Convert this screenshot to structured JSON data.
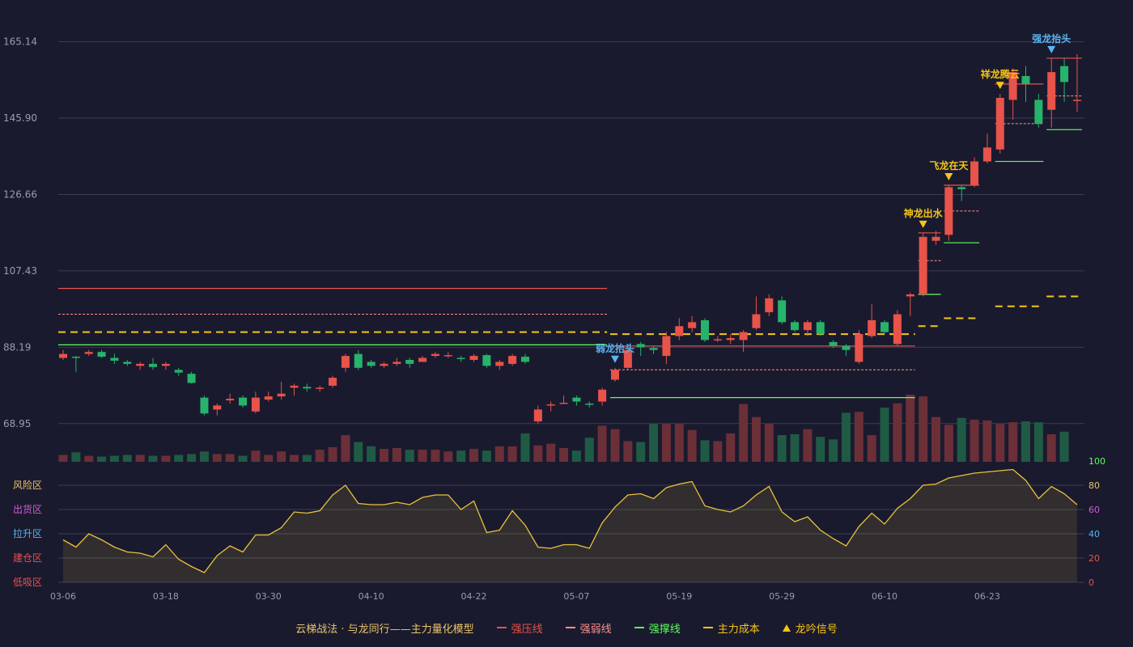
{
  "colors": {
    "background": "#1a1a2e",
    "grid": "#3a3d52",
    "up": "#e8534a",
    "down": "#26b36b",
    "volume_up": "#6b2f38",
    "volume_down": "#1f5a45",
    "strong_pressure": "#e8534a",
    "strong_weak": "#ff8f8f",
    "strong_support": "#5dff5d",
    "main_cost": "#f5c518",
    "signal_gold": "#f5c518",
    "signal_blue": "#5ab4f0",
    "oscillator_line": "#e8c23a",
    "axis_text": "#9a9cb0"
  },
  "legend": {
    "title": "云梯战法 · 与龙同行——主力量化模型",
    "strong_pressure": "强压线",
    "strong_weak": "强弱线",
    "strong_support": "强撑线",
    "main_cost": "主力成本",
    "signal": "龙吟信号"
  },
  "chart_data": {
    "type": "candlestick",
    "price_axis": {
      "ylim": [
        59.33,
        169.95
      ],
      "ticks": [
        "165.14",
        "145.90",
        "126.66",
        "107.43",
        "88.19",
        "68.95"
      ]
    },
    "x_tick_labels": [
      {
        "index": 0,
        "label": "03-06"
      },
      {
        "index": 8,
        "label": "03-18"
      },
      {
        "index": 16,
        "label": "03-30"
      },
      {
        "index": 24,
        "label": "04-10"
      },
      {
        "index": 32,
        "label": "04-22"
      },
      {
        "index": 40,
        "label": "05-07"
      },
      {
        "index": 48,
        "label": "05-19"
      },
      {
        "index": 56,
        "label": "05-29"
      },
      {
        "index": 64,
        "label": "06-10"
      },
      {
        "index": 72,
        "label": "06-23"
      }
    ],
    "candles": [
      [
        85.5,
        86.5,
        87.5,
        85.0
      ],
      [
        85.8,
        85.5,
        86.0,
        82.0
      ],
      [
        86.5,
        87.0,
        87.5,
        86.0
      ],
      [
        87.0,
        85.8,
        87.5,
        85.5
      ],
      [
        85.5,
        84.8,
        86.5,
        84.0
      ],
      [
        84.5,
        84.0,
        85.0,
        83.5
      ],
      [
        83.5,
        84.0,
        84.5,
        82.5
      ],
      [
        84.0,
        83.2,
        85.5,
        82.5
      ],
      [
        83.5,
        84.0,
        84.5,
        82.5
      ],
      [
        82.5,
        81.8,
        83.0,
        81.0
      ],
      [
        81.5,
        79.2,
        82.0,
        79.0
      ],
      [
        75.5,
        71.5,
        76.0,
        71.0
      ],
      [
        72.5,
        73.5,
        74.0,
        71.0
      ],
      [
        74.8,
        75.2,
        76.5,
        74.0
      ],
      [
        75.5,
        73.5,
        76.0,
        73.0
      ],
      [
        72.0,
        75.5,
        77.0,
        71.5
      ],
      [
        75.0,
        75.8,
        77.0,
        74.5
      ],
      [
        75.8,
        76.5,
        79.5,
        75.0
      ],
      [
        78.0,
        78.5,
        79.0,
        76.0
      ],
      [
        78.2,
        77.8,
        79.0,
        77.0
      ],
      [
        77.8,
        78.0,
        78.5,
        77.0
      ],
      [
        78.5,
        80.5,
        81.0,
        78.0
      ],
      [
        83.0,
        86.0,
        86.5,
        82.0
      ],
      [
        86.5,
        83.0,
        87.5,
        82.5
      ],
      [
        84.5,
        83.5,
        85.0,
        83.0
      ],
      [
        83.5,
        84.0,
        84.5,
        83.0
      ],
      [
        84.0,
        84.5,
        85.5,
        83.5
      ],
      [
        85.0,
        84.0,
        85.5,
        83.0
      ],
      [
        84.5,
        85.5,
        86.0,
        84.5
      ],
      [
        86.0,
        86.5,
        87.0,
        85.5
      ],
      [
        86.0,
        86.2,
        87.0,
        85.5
      ],
      [
        85.5,
        85.3,
        86.0,
        84.5
      ],
      [
        85.0,
        86.0,
        86.5,
        84.5
      ],
      [
        86.2,
        83.5,
        86.5,
        83.0
      ],
      [
        83.5,
        84.5,
        85.0,
        82.5
      ],
      [
        84.0,
        86.0,
        86.5,
        83.5
      ],
      [
        85.8,
        84.5,
        86.5,
        84.0
      ],
      [
        69.5,
        72.5,
        73.5,
        69.0
      ],
      [
        73.5,
        73.8,
        74.5,
        72.0
      ],
      [
        74.0,
        74.2,
        76.0,
        74.0
      ],
      [
        75.5,
        74.5,
        76.0,
        73.5
      ],
      [
        74.0,
        73.8,
        74.5,
        73.0
      ],
      [
        74.5,
        77.5,
        78.0,
        73.5
      ],
      [
        80.0,
        82.5,
        83.0,
        79.5
      ],
      [
        83.0,
        87.5,
        88.0,
        82.5
      ],
      [
        89.0,
        88.2,
        89.5,
        86.0
      ],
      [
        88.0,
        87.5,
        88.5,
        86.5
      ],
      [
        86.0,
        91.0,
        92.0,
        84.0
      ],
      [
        91.0,
        93.5,
        95.5,
        90.0
      ],
      [
        93.0,
        94.5,
        96.0,
        92.0
      ],
      [
        95.0,
        90.0,
        95.5,
        89.5
      ],
      [
        90.0,
        90.2,
        91.0,
        89.5
      ],
      [
        90.0,
        90.5,
        91.5,
        89.0
      ],
      [
        90.0,
        92.0,
        92.5,
        87.0
      ],
      [
        93.0,
        96.5,
        101.0,
        92.5
      ],
      [
        97.0,
        100.5,
        101.5,
        96.0
      ],
      [
        100.0,
        94.5,
        101.0,
        94.0
      ],
      [
        94.5,
        92.5,
        95.0,
        92.0
      ],
      [
        92.5,
        94.5,
        95.0,
        91.0
      ],
      [
        94.5,
        91.5,
        95.0,
        91.0
      ],
      [
        89.5,
        88.5,
        90.0,
        88.0
      ],
      [
        88.5,
        87.5,
        89.0,
        86.0
      ],
      [
        84.5,
        91.5,
        92.5,
        84.0
      ],
      [
        91.0,
        95.0,
        99.0,
        90.5
      ],
      [
        94.5,
        92.0,
        95.0,
        91.5
      ],
      [
        89.0,
        96.5,
        97.5,
        88.5
      ],
      [
        101.0,
        101.5,
        102.0,
        96.0
      ],
      [
        101.5,
        116.0,
        117.0,
        101.0
      ],
      [
        115.0,
        116.0,
        117.5,
        114.0
      ],
      [
        116.5,
        128.5,
        129.0,
        115.0
      ],
      [
        128.5,
        128.0,
        129.0,
        125.0
      ],
      [
        129.0,
        135.0,
        136.0,
        128.5
      ],
      [
        135.0,
        138.5,
        142.0,
        134.5
      ],
      [
        138.0,
        151.0,
        152.0,
        137.0
      ],
      [
        150.5,
        157.5,
        158.5,
        145.5
      ],
      [
        156.5,
        154.5,
        159.0,
        150.0
      ],
      [
        150.5,
        144.5,
        152.0,
        143.5
      ],
      [
        148.0,
        157.5,
        161.0,
        143.5
      ],
      [
        159.0,
        155.0,
        161.0,
        150.0
      ],
      [
        150.5,
        150.5,
        162.0,
        147.5
      ]
    ],
    "volume": [
      8,
      11,
      7,
      6,
      7,
      8,
      8,
      7,
      7,
      8,
      9,
      12,
      9,
      9,
      7,
      13,
      8,
      12,
      8,
      8,
      14,
      17,
      31,
      23,
      18,
      15,
      16,
      14,
      14,
      14,
      12,
      13,
      15,
      13,
      18,
      18,
      33,
      19,
      21,
      16,
      13,
      28,
      42,
      38,
      24,
      23,
      44,
      44,
      44,
      37,
      25,
      24,
      33,
      67,
      52,
      44,
      31,
      32,
      38,
      29,
      26,
      57,
      58,
      31,
      63,
      68,
      78,
      76,
      52,
      43,
      51,
      49,
      48,
      44,
      46,
      47,
      46,
      32,
      35
    ],
    "oscillator": {
      "ylim": [
        0,
        100
      ],
      "right_ticks": [
        "100",
        "80",
        "60",
        "40",
        "20",
        "0"
      ],
      "zones": [
        "风险区",
        "出货区",
        "拉升区",
        "建仓区",
        "低吸区"
      ],
      "values": [
        35,
        29,
        40,
        35,
        29,
        25,
        24,
        21,
        31,
        19,
        13,
        8,
        22,
        30,
        25,
        39,
        39,
        45,
        58,
        57,
        59,
        72,
        80,
        65,
        64,
        64,
        66,
        64,
        70,
        72,
        72,
        60,
        67,
        41,
        43,
        59,
        47,
        29,
        28,
        31,
        31,
        28,
        49,
        62,
        72,
        73,
        69,
        78,
        81,
        83,
        63,
        60,
        58,
        63,
        72,
        79,
        58,
        50,
        54,
        43,
        36,
        30,
        46,
        57,
        48,
        61,
        69,
        80,
        81,
        86,
        88,
        90,
        91,
        92,
        93,
        84,
        69,
        79,
        73,
        64
      ]
    },
    "annotations": [
      {
        "index": 43,
        "text": "弱龙抬头",
        "color": "blue"
      },
      {
        "index": 67,
        "text": "神龙出水",
        "color": "gold"
      },
      {
        "index": 69,
        "text": "飞龙在天",
        "color": "gold"
      },
      {
        "index": 73,
        "text": "祥龙腾云",
        "color": "gold"
      },
      {
        "index": 77,
        "text": "强龙抬头",
        "color": "blue"
      }
    ],
    "level_lines": [
      {
        "type": "strong_pressure",
        "start": 0,
        "end": 42,
        "value": 103.0
      },
      {
        "type": "strong_weak",
        "start": 0,
        "end": 42,
        "value": 96.5
      },
      {
        "type": "main_cost",
        "start": 0,
        "end": 42,
        "value": 92.0
      },
      {
        "type": "strong_support",
        "start": 0,
        "end": 42,
        "value": 88.8
      },
      {
        "type": "strong_pressure",
        "start": 43,
        "end": 66,
        "value": 88.5
      },
      {
        "type": "strong_weak",
        "start": 43,
        "end": 66,
        "value": 82.5
      },
      {
        "type": "main_cost",
        "start": 43,
        "end": 66,
        "value": 91.5
      },
      {
        "type": "strong_support",
        "start": 43,
        "end": 66,
        "value": 75.5
      },
      {
        "type": "strong_pressure",
        "start": 67,
        "end": 68,
        "value": 117.0
      },
      {
        "type": "strong_weak",
        "start": 67,
        "end": 68,
        "value": 110.0
      },
      {
        "type": "main_cost",
        "start": 67,
        "end": 68,
        "value": 93.5
      },
      {
        "type": "strong_support",
        "start": 67,
        "end": 68,
        "value": 101.5
      },
      {
        "type": "strong_pressure",
        "start": 69,
        "end": 71,
        "value": 129.0
      },
      {
        "type": "strong_weak",
        "start": 69,
        "end": 71,
        "value": 122.5
      },
      {
        "type": "main_cost",
        "start": 69,
        "end": 71,
        "value": 95.5
      },
      {
        "type": "strong_support",
        "start": 69,
        "end": 71,
        "value": 114.5
      },
      {
        "type": "strong_pressure",
        "start": 73,
        "end": 76,
        "value": 154.5
      },
      {
        "type": "strong_weak",
        "start": 73,
        "end": 76,
        "value": 144.5
      },
      {
        "type": "main_cost",
        "start": 73,
        "end": 76,
        "value": 98.5
      },
      {
        "type": "strong_support",
        "start": 73,
        "end": 76,
        "value": 135.0
      },
      {
        "type": "strong_pressure",
        "start": 77,
        "end": 79,
        "value": 161.0
      },
      {
        "type": "strong_weak",
        "start": 77,
        "end": 79,
        "value": 151.5
      },
      {
        "type": "main_cost",
        "start": 77,
        "end": 79,
        "value": 101.0
      },
      {
        "type": "strong_support",
        "start": 77,
        "end": 79,
        "value": 143.0
      }
    ]
  }
}
